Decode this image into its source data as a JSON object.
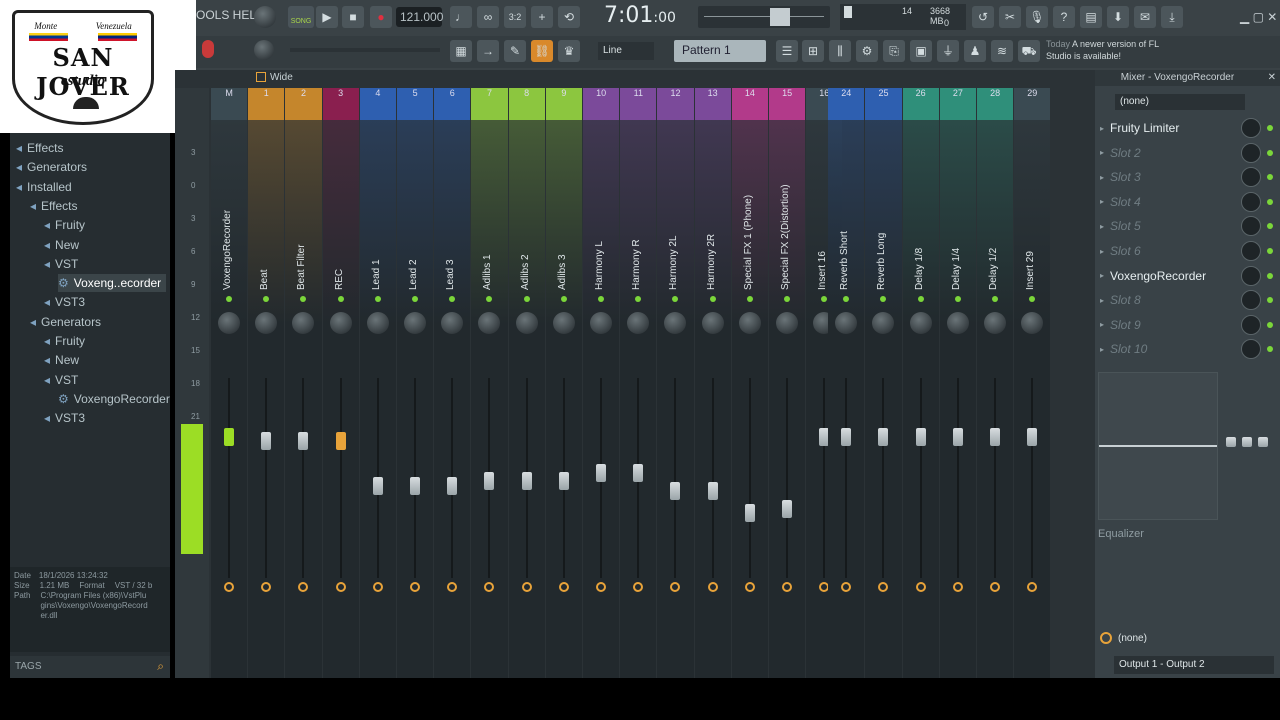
{
  "logo": {
    "top_left": "Monte",
    "top_right": "Venezuela",
    "main": "SAN JOVER",
    "sub": "estudio"
  },
  "toolbar": {
    "menu_label": "OOLS HELP",
    "song_label": "SONG",
    "tempo": "121.000",
    "time": "7:01",
    "time_sub": ":00",
    "cpu": "14",
    "memory": "3668 MB",
    "memory_sub": "0",
    "snap": "Line",
    "pattern": "Pattern 1",
    "news_today": "Today",
    "news_text": "A newer version of FL Studio is available!"
  },
  "browser": {
    "items": [
      {
        "label": "Effects",
        "level": 0
      },
      {
        "label": "Generators",
        "level": 0
      },
      {
        "label": "Installed",
        "level": 0
      },
      {
        "label": "Effects",
        "level": 1
      },
      {
        "label": "Fruity",
        "level": 2
      },
      {
        "label": "New",
        "level": 2
      },
      {
        "label": "VST",
        "level": 2
      },
      {
        "label": "Voxeng..ecorder",
        "level": 3
      },
      {
        "label": "VST3",
        "level": 2
      },
      {
        "label": "Generators",
        "level": 1
      },
      {
        "label": "Fruity",
        "level": 2
      },
      {
        "label": "New",
        "level": 2
      },
      {
        "label": "VST",
        "level": 2
      },
      {
        "label": "VoxengoRecorder",
        "level": 3
      },
      {
        "label": "VST3",
        "level": 2
      }
    ],
    "info": {
      "date_label": "Date",
      "date": "18/1/2026 13:24:32",
      "size_label": "Size",
      "size": "1.21 MB",
      "format_label": "Format",
      "format": "VST / 32 b",
      "path_label": "Path",
      "path": "C:\\Program Files (x86)\\VstPlugins\\Voxengo\\VoxengoRecorder.dll"
    },
    "tags_label": "TAGS"
  },
  "mixer": {
    "view_label": "Wide",
    "scale": [
      "3",
      "0",
      "3",
      "6",
      "9",
      "12",
      "15",
      "18",
      "21"
    ],
    "strips": [
      {
        "num": "M",
        "name": "VoxengoRecorder",
        "color": "#3a4a52",
        "fader": 0.72
      },
      {
        "num": "1",
        "name": "Beat",
        "color": "#c5862c",
        "fader": 0.7
      },
      {
        "num": "2",
        "name": "Beat Filter",
        "color": "#c5862c",
        "fader": 0.7
      },
      {
        "num": "3",
        "name": "REC",
        "color": "#8a1f4f",
        "fader": 0.7
      },
      {
        "num": "4",
        "name": "Lead 1",
        "color": "#2e5fb0",
        "fader": 0.45
      },
      {
        "num": "5",
        "name": "Lead 2",
        "color": "#2e5fb0",
        "fader": 0.45
      },
      {
        "num": "6",
        "name": "Lead 3",
        "color": "#2e5fb0",
        "fader": 0.45
      },
      {
        "num": "7",
        "name": "Adlibs 1",
        "color": "#8cc63f",
        "fader": 0.48
      },
      {
        "num": "8",
        "name": "Adlibs 2",
        "color": "#8cc63f",
        "fader": 0.48
      },
      {
        "num": "9",
        "name": "Adlibs 3",
        "color": "#8cc63f",
        "fader": 0.48
      },
      {
        "num": "10",
        "name": "Harmony L",
        "color": "#7b4a9a",
        "fader": 0.52
      },
      {
        "num": "11",
        "name": "Harmony R",
        "color": "#7b4a9a",
        "fader": 0.52
      },
      {
        "num": "12",
        "name": "Harmony 2L",
        "color": "#7b4a9a",
        "fader": 0.42
      },
      {
        "num": "13",
        "name": "Harmony 2R",
        "color": "#7b4a9a",
        "fader": 0.42
      },
      {
        "num": "14",
        "name": "Special FX 1 (Phone)",
        "color": "#b23a8a",
        "fader": 0.3
      },
      {
        "num": "15",
        "name": "Special FX 2(Distortion)",
        "color": "#b23a8a",
        "fader": 0.32
      },
      {
        "num": "16",
        "name": "Insert 16",
        "color": "#3a4a52",
        "fader": 0.72
      },
      {
        "num": "24",
        "name": "Reverb Short",
        "color": "#2e5fb0",
        "fader": 0.72
      },
      {
        "num": "25",
        "name": "Reverb Long",
        "color": "#2e5fb0",
        "fader": 0.72
      },
      {
        "num": "26",
        "name": "Delay 1/8",
        "color": "#2f8f7a",
        "fader": 0.72
      },
      {
        "num": "27",
        "name": "Delay 1/4",
        "color": "#2f8f7a",
        "fader": 0.72
      },
      {
        "num": "28",
        "name": "Delay 1/2",
        "color": "#2f8f7a",
        "fader": 0.72
      },
      {
        "num": "29",
        "name": "Insert 29",
        "color": "#3a4a52",
        "fader": 0.72
      }
    ]
  },
  "panel": {
    "title": "Mixer - VoxengoRecorder",
    "input": "(none)",
    "slots": [
      {
        "label": "Fruity Limiter",
        "active": true
      },
      {
        "label": "Slot 2",
        "active": false
      },
      {
        "label": "Slot 3",
        "active": false
      },
      {
        "label": "Slot 4",
        "active": false
      },
      {
        "label": "Slot 5",
        "active": false
      },
      {
        "label": "Slot 6",
        "active": false
      },
      {
        "label": "VoxengoRecorder",
        "active": true
      },
      {
        "label": "Slot 8",
        "active": false
      },
      {
        "label": "Slot 9",
        "active": false
      },
      {
        "label": "Slot 10",
        "active": false
      }
    ],
    "eq_label": "Equalizer",
    "send": "(none)",
    "output": "Output 1 - Output 2"
  }
}
